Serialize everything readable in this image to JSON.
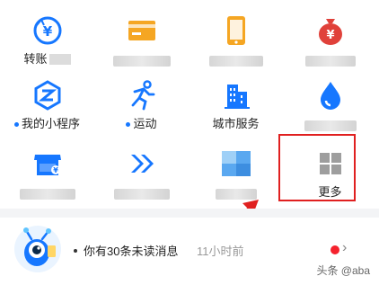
{
  "grid": {
    "items": [
      {
        "id": "transfer",
        "label": "转账",
        "icon": "transfer-icon"
      },
      {
        "id": "bank-card",
        "label": "",
        "icon": "card-icon"
      },
      {
        "id": "phone-recharge",
        "label": "",
        "icon": "phone-icon"
      },
      {
        "id": "money-bag",
        "label": "",
        "icon": "money-bag-icon"
      },
      {
        "id": "mini-programs",
        "label": "我的小程序",
        "icon": "mini-program-icon",
        "dot": true
      },
      {
        "id": "sports",
        "label": "运动",
        "icon": "running-icon",
        "dot": true
      },
      {
        "id": "city-services",
        "label": "城市服务",
        "icon": "building-icon"
      },
      {
        "id": "water",
        "label": "",
        "icon": "water-drop-icon"
      },
      {
        "id": "store",
        "label": "",
        "icon": "store-icon"
      },
      {
        "id": "forward",
        "label": "",
        "icon": "double-chevron-icon"
      },
      {
        "id": "blurred",
        "label": "",
        "icon": "square-blocks-icon"
      },
      {
        "id": "more",
        "label": "更多",
        "icon": "grid-four-icon"
      }
    ]
  },
  "message": {
    "text": "你有30条未读消息",
    "time": "11小时前"
  },
  "watermark": "头条 @aba",
  "colors": {
    "accent": "#1677ff",
    "orange": "#f5a623",
    "red": "#e02020"
  }
}
